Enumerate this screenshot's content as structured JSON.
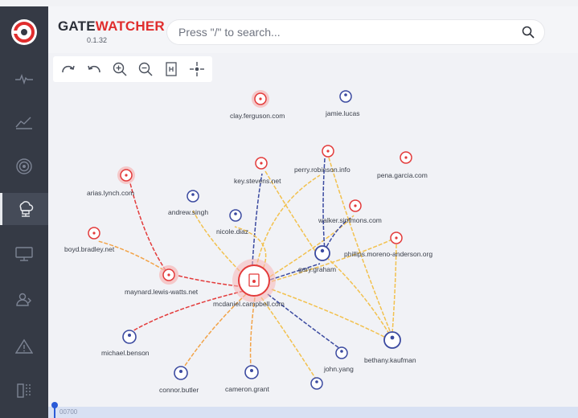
{
  "app": {
    "brand_part1": "GATE",
    "brand_part2": "WATCHER",
    "version": "0.1.32",
    "accent_color": "#e02d2d",
    "node_blue": "#3b4aa0"
  },
  "search": {
    "placeholder": "Press \"/\" to search..."
  },
  "sidebar": {
    "items": [
      {
        "icon": "pulse-icon"
      },
      {
        "icon": "area-chart-icon"
      },
      {
        "icon": "radar-icon"
      },
      {
        "icon": "cloud-network-icon",
        "active": true
      },
      {
        "icon": "monitor-icon"
      },
      {
        "icon": "users-icon"
      },
      {
        "icon": "warning-icon"
      },
      {
        "icon": "split-view-icon"
      }
    ]
  },
  "toolbar": {
    "tools": [
      "redo-icon",
      "undo-icon",
      "zoom-in-icon",
      "zoom-out-icon",
      "fit-page-icon",
      "center-icon"
    ]
  },
  "graph": {
    "nodes": [
      {
        "label": "clay.ferguson.com",
        "kind": "domain",
        "highlight": true
      },
      {
        "label": "jamie.lucas",
        "kind": "user"
      },
      {
        "label": "key.stevens.net",
        "kind": "domain"
      },
      {
        "label": "perry.robinson.info",
        "kind": "domain"
      },
      {
        "label": "pena.garcia.com",
        "kind": "domain"
      },
      {
        "label": "arias.lynch.com",
        "kind": "domain",
        "highlight": true
      },
      {
        "label": "andrew.singh",
        "kind": "user"
      },
      {
        "label": "nicole.diaz",
        "kind": "user"
      },
      {
        "label": "walker.simmons.com",
        "kind": "domain"
      },
      {
        "label": "boyd.bradley.net",
        "kind": "domain"
      },
      {
        "label": "phillips.moreno-anderson.org",
        "kind": "domain"
      },
      {
        "label": "gary.graham",
        "kind": "user"
      },
      {
        "label": "maynard.lewis-watts.net",
        "kind": "domain",
        "highlight": true
      },
      {
        "label": "mcdaniel.campbell.com",
        "kind": "host",
        "highlight": true
      },
      {
        "label": "michael.benson",
        "kind": "user"
      },
      {
        "label": "bethany.kaufman",
        "kind": "user"
      },
      {
        "label": "john.yang",
        "kind": "user"
      },
      {
        "label": "connor.butler",
        "kind": "user"
      },
      {
        "label": "cameron.grant",
        "kind": "user"
      },
      {
        "label": "",
        "kind": "user"
      }
    ]
  },
  "timeline": {
    "label": "00700"
  }
}
